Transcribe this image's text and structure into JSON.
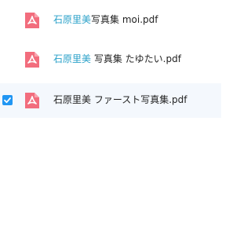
{
  "files": [
    {
      "highlight": "石原里美",
      "rest": "写真集 moi.pdf",
      "selected": false,
      "icon": "pdf-icon"
    },
    {
      "highlight": "石原里美",
      "rest": " 写真集 たゆたい.pdf",
      "selected": false,
      "icon": "pdf-icon"
    },
    {
      "highlight": "",
      "rest": "石原里美 ファースト写真集.pdf",
      "selected": true,
      "icon": "pdf-icon"
    }
  ],
  "colors": {
    "pdf_icon": "#f26d7d",
    "highlight_text": "#2aa1c9",
    "checkbox": "#2196f3",
    "selected_row_bg": "#f4f8fd"
  }
}
